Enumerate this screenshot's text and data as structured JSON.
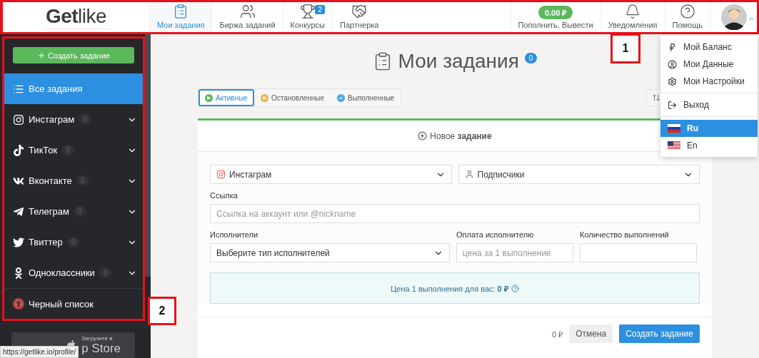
{
  "header": {
    "logo_bold": "Get",
    "logo_light": "like",
    "nav": [
      {
        "label": "Мои задания",
        "selected": true,
        "kind": "tasks"
      },
      {
        "label": "Биржа заданий",
        "selected": false,
        "kind": "exchange"
      },
      {
        "label": "Конкурсы",
        "selected": false,
        "kind": "contests",
        "badge": "2"
      },
      {
        "label": "Партнерка",
        "selected": false,
        "kind": "partner"
      }
    ],
    "balance": {
      "amount": "0.00 ₽",
      "label": "Пополнить, Вывести"
    },
    "notifications": "Уведомления",
    "help": "Помощь"
  },
  "profile_menu": {
    "items": [
      {
        "label": "Мой Баланс",
        "kind": "balance"
      },
      {
        "label": "Мои Данные",
        "kind": "profile"
      },
      {
        "label": "Мои Настройки",
        "kind": "settings"
      },
      {
        "label": "Выход",
        "kind": "logout"
      }
    ],
    "languages": [
      {
        "label": "Ru",
        "kind": "ru",
        "selected": true
      },
      {
        "label": "En",
        "kind": "en",
        "selected": false
      }
    ]
  },
  "sidebar": {
    "create_button": "Создать задание",
    "items": [
      {
        "label": "Все задания",
        "kind": "all",
        "selected": true
      },
      {
        "label": "Инстаграм",
        "kind": "instagram",
        "count": "0",
        "selected": false
      },
      {
        "label": "ТикТок",
        "kind": "tiktok",
        "count": "0",
        "selected": false
      },
      {
        "label": "Вконтакте",
        "kind": "vk",
        "count": "0",
        "selected": false
      },
      {
        "label": "Телеграм",
        "kind": "telegram",
        "count": "0",
        "selected": false
      },
      {
        "label": "Твиттер",
        "kind": "twitter",
        "count": "0",
        "selected": false
      },
      {
        "label": "Одноклассники",
        "kind": "ok",
        "count": "0",
        "selected": false
      }
    ],
    "blacklist": "Черный список",
    "app_store": {
      "caption": "Загрузите в",
      "name": "p Store"
    }
  },
  "page": {
    "title": "Мои задания",
    "count": "0",
    "filters": [
      {
        "label": "Активные",
        "kind": "active",
        "selected": true
      },
      {
        "label": "Остановленные",
        "kind": "stopped",
        "selected": false
      },
      {
        "label": "Выполненные",
        "kind": "done",
        "selected": false
      }
    ],
    "new_task": "Новое **задание**",
    "form": {
      "network": "Инстаграм",
      "task_type": "Подписчики",
      "link_label": "Ссылка",
      "link_placeholder": "Ссылка на аккаунт или @nickname",
      "performers_label": "Исполнители",
      "performers_value": "Выберите тип исполнителей",
      "payment_label": "Оплата исполнителю",
      "payment_placeholder": "цена за 1 выполнение",
      "quantity_label": "Количество выполнений",
      "price_note": "Цена 1 выполнения для вас: **0 ₽**",
      "total": "0 ₽",
      "cancel": "Отмена",
      "submit": "Создать задание"
    }
  },
  "annotations": [
    {
      "label": "1"
    },
    {
      "label": "2"
    }
  ],
  "status_url": "https://getlike.io/profile/"
}
